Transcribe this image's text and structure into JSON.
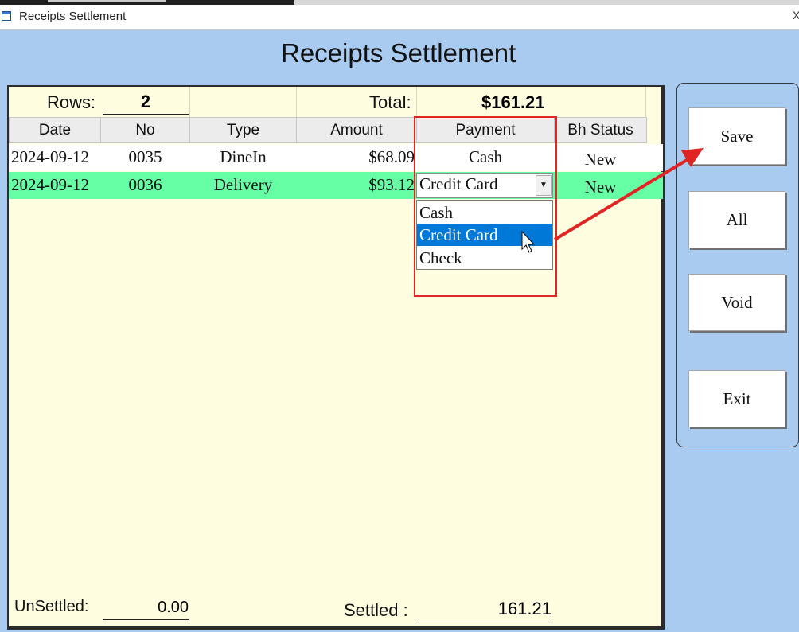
{
  "window": {
    "title": "Receipts Settlement"
  },
  "heading": "Receipts Settlement",
  "summary": {
    "rows_label": "Rows:",
    "rows_value": "2",
    "total_label": "Total:",
    "total_value": "$161.21"
  },
  "table": {
    "columns": [
      "Date",
      "No",
      "Type",
      "Amount",
      "Payment",
      "Bh Status"
    ],
    "rows": [
      {
        "date": "2024-09-12",
        "no": "0035",
        "type": "DineIn",
        "amount": "$68.09",
        "payment": "Cash",
        "status": "New"
      },
      {
        "date": "2024-09-12",
        "no": "0036",
        "type": "Delivery",
        "amount": "$93.12",
        "payment": "Credit Card",
        "status": "New"
      }
    ],
    "selected_row_color": "#66ffa6"
  },
  "payment_dropdown": {
    "selected": "Credit Card",
    "options": [
      "Cash",
      "Credit Card",
      "Check"
    ],
    "highlight_color": "#0078d7"
  },
  "footer": {
    "unsettled_label": "UnSettled:",
    "unsettled_value": "0.00",
    "settled_label": "Settled :",
    "settled_value": "161.21"
  },
  "buttons": {
    "save": "Save",
    "all": "All",
    "void": "Void",
    "exit": "Exit"
  },
  "annotation": {
    "color": "#e02525"
  }
}
